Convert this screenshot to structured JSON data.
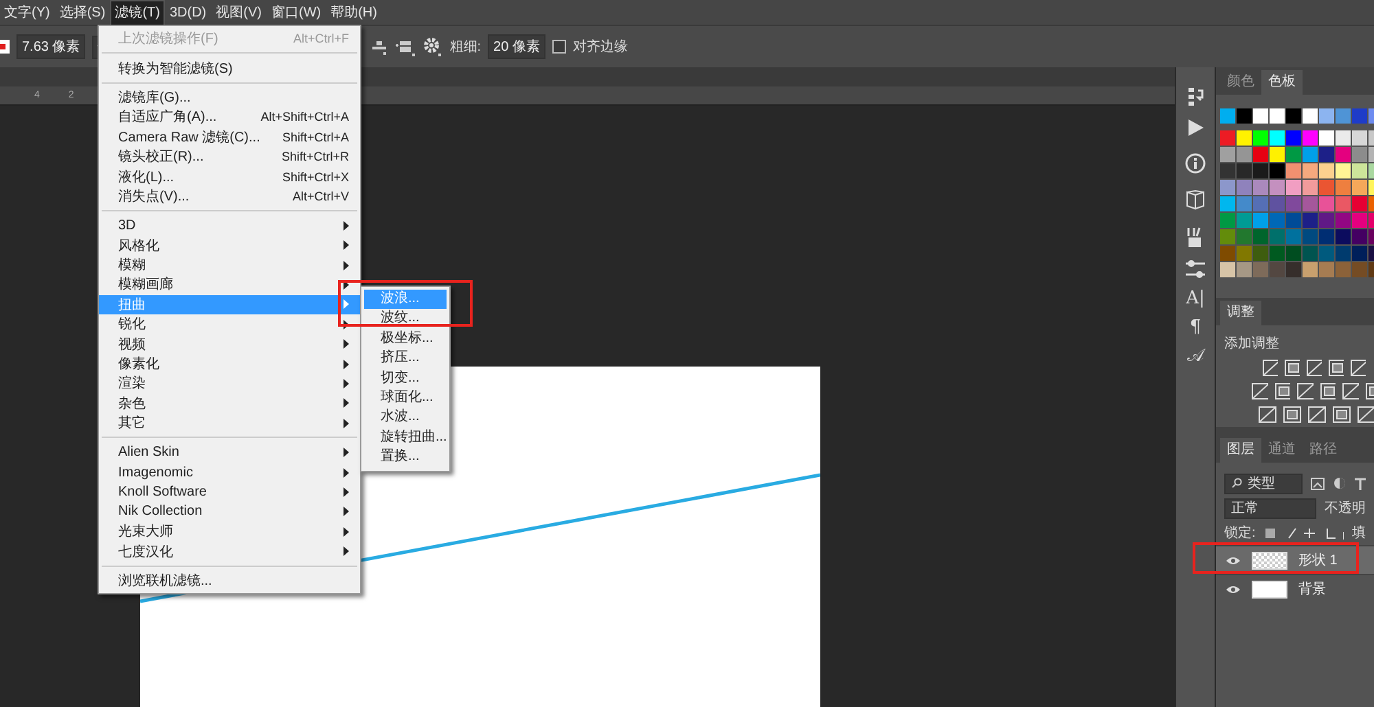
{
  "menu_bar": [
    {
      "label": "文字(Y)",
      "selected": false
    },
    {
      "label": "选择(S)",
      "selected": false
    },
    {
      "label": "滤镜(T)",
      "selected": true
    },
    {
      "label": "3D(D)",
      "selected": false
    },
    {
      "label": "视图(V)",
      "selected": false
    },
    {
      "label": "窗口(W)",
      "selected": false
    },
    {
      "label": "帮助(H)",
      "selected": false
    }
  ],
  "options_bar": {
    "width_value": "7.63 像素",
    "weight_label": "粗细:",
    "weight_value": "20 像素",
    "align_edges": {
      "label": "对齐边缘",
      "checked": false
    }
  },
  "ruler": [
    "4",
    "2"
  ],
  "filter_menu": {
    "groups": [
      [
        {
          "kind": "command",
          "label": "上次滤镜操作(F)",
          "shortcut": "Alt+Ctrl+F",
          "disabled": true,
          "selected": false
        }
      ],
      [
        {
          "kind": "command",
          "label": "转换为智能滤镜(S)",
          "disabled": false,
          "selected": false
        }
      ],
      [
        {
          "kind": "command",
          "label": "滤镜库(G)...",
          "disabled": false,
          "selected": false
        },
        {
          "kind": "command",
          "label": "自适应广角(A)...",
          "shortcut": "Alt+Shift+Ctrl+A",
          "disabled": false,
          "selected": false
        },
        {
          "kind": "command",
          "label": "Camera Raw 滤镜(C)...",
          "shortcut": "Shift+Ctrl+A",
          "disabled": false,
          "selected": false
        },
        {
          "kind": "command",
          "label": "镜头校正(R)...",
          "shortcut": "Shift+Ctrl+R",
          "disabled": false,
          "selected": false
        },
        {
          "kind": "command",
          "label": "液化(L)...",
          "shortcut": "Shift+Ctrl+X",
          "disabled": false,
          "selected": false
        },
        {
          "kind": "command",
          "label": "消失点(V)...",
          "shortcut": "Alt+Ctrl+V",
          "disabled": false,
          "selected": false
        }
      ],
      [
        {
          "kind": "submenu",
          "label": "3D",
          "disabled": false,
          "selected": false
        },
        {
          "kind": "submenu",
          "label": "风格化",
          "disabled": false,
          "selected": false
        },
        {
          "kind": "submenu",
          "label": "模糊",
          "disabled": false,
          "selected": false
        },
        {
          "kind": "submenu",
          "label": "模糊画廊",
          "disabled": false,
          "selected": false
        },
        {
          "kind": "submenu",
          "label": "扭曲",
          "disabled": false,
          "selected": true
        },
        {
          "kind": "submenu",
          "label": "锐化",
          "disabled": false,
          "selected": false
        },
        {
          "kind": "submenu",
          "label": "视频",
          "disabled": false,
          "selected": false
        },
        {
          "kind": "submenu",
          "label": "像素化",
          "disabled": false,
          "selected": false
        },
        {
          "kind": "submenu",
          "label": "渲染",
          "disabled": false,
          "selected": false
        },
        {
          "kind": "submenu",
          "label": "杂色",
          "disabled": false,
          "selected": false
        },
        {
          "kind": "submenu",
          "label": "其它",
          "disabled": false,
          "selected": false
        }
      ],
      [
        {
          "kind": "submenu",
          "label": "Alien Skin",
          "disabled": false,
          "selected": false
        },
        {
          "kind": "submenu",
          "label": "Imagenomic",
          "disabled": false,
          "selected": false
        },
        {
          "kind": "submenu",
          "label": "Knoll Software",
          "disabled": false,
          "selected": false
        },
        {
          "kind": "submenu",
          "label": "Nik Collection",
          "disabled": false,
          "selected": false
        },
        {
          "kind": "submenu",
          "label": "光束大师",
          "disabled": false,
          "selected": false
        },
        {
          "kind": "submenu",
          "label": "七度汉化",
          "disabled": false,
          "selected": false
        }
      ],
      [
        {
          "kind": "command",
          "label": "浏览联机滤镜...",
          "disabled": false,
          "selected": false
        }
      ]
    ]
  },
  "distort_submenu": [
    {
      "label": "波浪...",
      "selected": true
    },
    {
      "label": "波纹...",
      "selected": false
    },
    {
      "label": "极坐标...",
      "selected": false
    },
    {
      "label": "挤压...",
      "selected": false
    },
    {
      "label": "切变...",
      "selected": false
    },
    {
      "label": "球面化...",
      "selected": false
    },
    {
      "label": "水波...",
      "selected": false
    },
    {
      "label": "旋转扭曲...",
      "selected": false
    },
    {
      "label": "置换...",
      "selected": false
    }
  ],
  "tool_icons": [
    {
      "kind": "history"
    },
    {
      "kind": "play"
    },
    {
      "kind": "info"
    },
    {
      "kind": "cube"
    },
    {
      "kind": "brush"
    },
    {
      "kind": "sliders"
    },
    {
      "kind": "glyph",
      "text": "A|"
    },
    {
      "kind": "glyph",
      "text": "¶"
    },
    {
      "kind": "glyph",
      "text": "𝒜"
    }
  ],
  "swatches_panel": {
    "tabs": [
      {
        "label": "颜色",
        "selected": false
      },
      {
        "label": "色板",
        "selected": true
      }
    ],
    "recent": [
      {
        "color": "#00aeef"
      },
      {
        "color": "#000000"
      },
      {
        "color": "#ffffff"
      },
      {
        "color": "#ffffff"
      },
      {
        "color": "#000000"
      },
      {
        "color": "#ffffff"
      },
      {
        "color": "#8cb4f0"
      },
      {
        "color": "#4f94d6"
      },
      {
        "color": "#1e3cc8"
      },
      {
        "color": "#6e8cf0"
      }
    ],
    "rows": [
      [
        {
          "color": "#ed1c24"
        },
        {
          "color": "#fff200"
        },
        {
          "color": "#00ff00"
        },
        {
          "color": "#00ffff"
        },
        {
          "color": "#0000ff"
        },
        {
          "color": "#ff00ff"
        },
        {
          "color": "#ffffff"
        },
        {
          "color": "#ebebeb"
        },
        {
          "color": "#d7d7d7"
        },
        {
          "color": "#c8c8c8"
        }
      ],
      [
        {
          "color": "#a0a0a0"
        },
        {
          "color": "#959595"
        },
        {
          "color": "#e60012"
        },
        {
          "color": "#fff100"
        },
        {
          "color": "#009944"
        },
        {
          "color": "#00a0e9"
        },
        {
          "color": "#1d2088"
        },
        {
          "color": "#e4007f"
        },
        {
          "color": "#8c8c8c"
        },
        {
          "color": "#b4b4b4"
        }
      ],
      [
        {
          "color": "#333333"
        },
        {
          "color": "#282828"
        },
        {
          "color": "#1a1a1a"
        },
        {
          "color": "#000000"
        },
        {
          "color": "#f19070"
        },
        {
          "color": "#f6a97e"
        },
        {
          "color": "#fcd08e"
        },
        {
          "color": "#fff595"
        },
        {
          "color": "#cde59a"
        },
        {
          "color": "#aad8a0"
        }
      ],
      [
        {
          "color": "#8c97cb"
        },
        {
          "color": "#8f82bc"
        },
        {
          "color": "#aa89bd"
        },
        {
          "color": "#c490bf"
        },
        {
          "color": "#f19ec2"
        },
        {
          "color": "#f29b9b"
        },
        {
          "color": "#ea5532"
        },
        {
          "color": "#ee7f3f"
        },
        {
          "color": "#f5a85a"
        },
        {
          "color": "#fff45c"
        }
      ],
      [
        {
          "color": "#00b7ee"
        },
        {
          "color": "#448aca"
        },
        {
          "color": "#556fb5"
        },
        {
          "color": "#5f52a0"
        },
        {
          "color": "#80499c"
        },
        {
          "color": "#a5579b"
        },
        {
          "color": "#e85298"
        },
        {
          "color": "#ea5864"
        },
        {
          "color": "#e60033"
        },
        {
          "color": "#eb6100"
        }
      ],
      [
        {
          "color": "#009944"
        },
        {
          "color": "#009b95"
        },
        {
          "color": "#00a0e9"
        },
        {
          "color": "#0068b7"
        },
        {
          "color": "#004b97"
        },
        {
          "color": "#1d2088"
        },
        {
          "color": "#601986"
        },
        {
          "color": "#920783"
        },
        {
          "color": "#e4007f"
        },
        {
          "color": "#e5006a"
        }
      ],
      [
        {
          "color": "#638c0b"
        },
        {
          "color": "#22782e"
        },
        {
          "color": "#00652c"
        },
        {
          "color": "#00706b"
        },
        {
          "color": "#00719e"
        },
        {
          "color": "#004a80"
        },
        {
          "color": "#002e73"
        },
        {
          "color": "#0c0c5e"
        },
        {
          "color": "#440062"
        },
        {
          "color": "#6a005f"
        }
      ],
      [
        {
          "color": "#7f4b00"
        },
        {
          "color": "#817800"
        },
        {
          "color": "#3e5d0f"
        },
        {
          "color": "#005a20"
        },
        {
          "color": "#004d20"
        },
        {
          "color": "#005450"
        },
        {
          "color": "#005a7e"
        },
        {
          "color": "#003b6e"
        },
        {
          "color": "#001f5a"
        },
        {
          "color": "#1a1043"
        }
      ],
      [
        {
          "color": "#d7c4a7"
        },
        {
          "color": "#a69885"
        },
        {
          "color": "#7e6b5a"
        },
        {
          "color": "#534741"
        },
        {
          "color": "#362e2b"
        },
        {
          "color": "#c8a06e"
        },
        {
          "color": "#a67c52"
        },
        {
          "color": "#8c6239"
        },
        {
          "color": "#754c24"
        },
        {
          "color": "#603913"
        }
      ]
    ]
  },
  "adjustments_panel": {
    "tab": "调整",
    "heading": "添加调整"
  },
  "layers_panel": {
    "tabs": [
      {
        "label": "图层",
        "selected": true
      },
      {
        "label": "通道",
        "selected": false
      },
      {
        "label": "路径",
        "selected": false
      }
    ],
    "filter": "类型",
    "blend_mode": "正常",
    "opacity_label": "不透明",
    "lock_label": "锁定:",
    "fill_label": "填",
    "layers": [
      {
        "name": "形状 1",
        "transparent_thumbnail": true,
        "selected": true
      },
      {
        "name": "背景",
        "transparent_thumbnail": false,
        "selected": false
      }
    ]
  }
}
